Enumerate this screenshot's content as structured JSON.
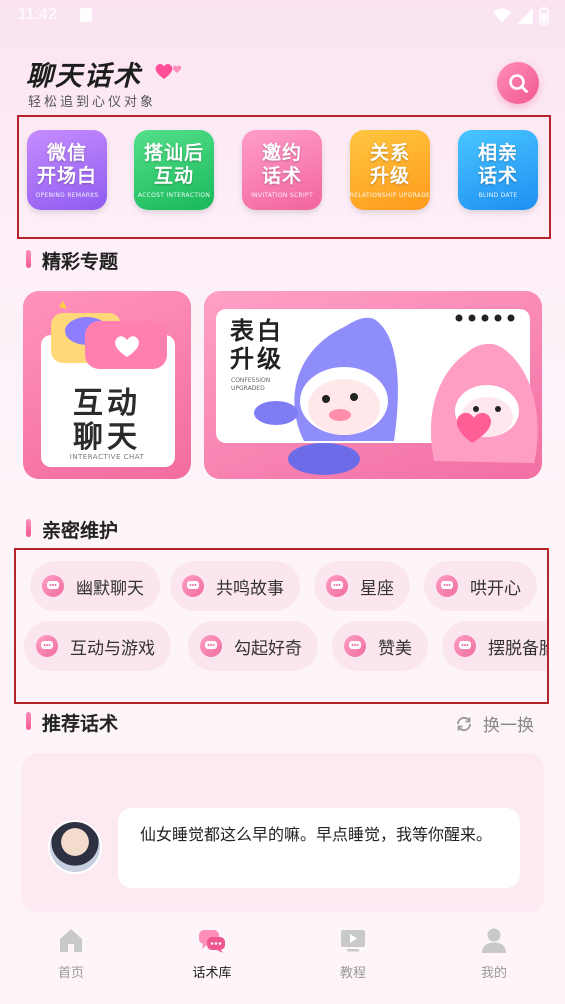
{
  "status_bar": {
    "time": "11:42"
  },
  "header": {
    "title": "聊天话术",
    "subtitle": "轻松追到心仪对象"
  },
  "categories": [
    {
      "big": "微信\n开场白",
      "small": "OPENING REMARKS",
      "color_from": "#c68cff",
      "color_to": "#8f5cf0"
    },
    {
      "big": "搭讪后\n互动",
      "small": "ACCOST INTERACTION",
      "color_from": "#53e08a",
      "color_to": "#19b85a"
    },
    {
      "big": "邀约\n话术",
      "small": "INVITATION SCRIPT",
      "color_from": "#ff9ec9",
      "color_to": "#f2649f"
    },
    {
      "big": "关系\n升级",
      "small": "RELATIONSHIP UPGRADE",
      "color_from": "#ffc640",
      "color_to": "#ff9a1c"
    },
    {
      "big": "相亲\n话术",
      "small": "BLIND DATE",
      "color_from": "#49c6ff",
      "color_to": "#1e8ff2"
    }
  ],
  "featured": {
    "section_title": "精彩专题",
    "left": {
      "title": "互动\n聊天",
      "subtitle": "INTERACTIVE CHAT"
    },
    "right": {
      "title": "表白\n升级",
      "subtitle": "CONFESSION\nUPGRADED"
    }
  },
  "intimacy": {
    "section_title": "亲密维护",
    "row1": [
      "幽默聊天",
      "共鸣故事",
      "星座",
      "哄开心"
    ],
    "row2": [
      "互动与游戏",
      "勾起好奇",
      "赞美",
      "摆脱备胎"
    ]
  },
  "recommend": {
    "section_title": "推荐话术",
    "refresh_label": "换一换",
    "message": "仙女睡觉都这么早的嘛。早点睡觉，我等你醒来。"
  },
  "tabbar": [
    {
      "label": "首页",
      "icon": "home-icon",
      "active": false
    },
    {
      "label": "话术库",
      "icon": "chat-bubbles-icon",
      "active": true
    },
    {
      "label": "教程",
      "icon": "play-screen-icon",
      "active": false
    },
    {
      "label": "我的",
      "icon": "user-icon",
      "active": false
    }
  ],
  "colors": {
    "accent": "#f1578f",
    "tag_bg": "#fbe6f0",
    "highlight_border": "#b5232a"
  }
}
